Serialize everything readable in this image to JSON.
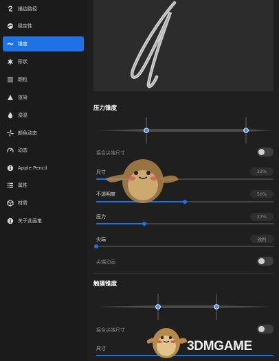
{
  "sidebar": {
    "items": [
      {
        "label": "描边路径",
        "icon": "stroke-path-icon"
      },
      {
        "label": "稳定性",
        "icon": "stabilization-icon"
      },
      {
        "label": "锥度",
        "icon": "taper-icon",
        "active": true
      },
      {
        "label": "形状",
        "icon": "shape-icon"
      },
      {
        "label": "颗粒",
        "icon": "grain-icon"
      },
      {
        "label": "渲染",
        "icon": "rendering-icon"
      },
      {
        "label": "湿混",
        "icon": "wet-mix-icon"
      },
      {
        "label": "颜色动态",
        "icon": "color-dynamics-icon"
      },
      {
        "label": "动态",
        "icon": "dynamics-icon"
      },
      {
        "label": "Apple Pencil",
        "icon": "apple-pencil-icon"
      },
      {
        "label": "属性",
        "icon": "properties-icon"
      },
      {
        "label": "材质",
        "icon": "materials-icon"
      },
      {
        "label": "关于此画笔",
        "icon": "about-brush-icon"
      }
    ]
  },
  "pressure_taper": {
    "title": "压力锥度",
    "tip_size_link_label": "接合尖端尺寸",
    "tip_size_link_on": false,
    "size": {
      "label": "尺寸",
      "value": "22%",
      "fraction": 0.22
    },
    "opacity": {
      "label": "不透明度",
      "value": "50%",
      "fraction": 0.5
    },
    "pressure": {
      "label": "压力",
      "value": "27%",
      "fraction": 0.27
    },
    "tip": {
      "label": "尖端",
      "value": "锐利",
      "fraction": 0.0
    },
    "tip_animation_label": "尖端动画",
    "tip_animation_on": false
  },
  "touch_taper": {
    "title": "触摸锥度",
    "tip_size_link_label": "接合尖端尺寸",
    "tip_size_link_on": false,
    "size": {
      "label": "尺寸"
    }
  },
  "watermark": {
    "text": "3DMGAME"
  },
  "colors": {
    "accent": "#1e72e5",
    "background": "#1b1b1b",
    "panel": "#1f1f1f"
  }
}
